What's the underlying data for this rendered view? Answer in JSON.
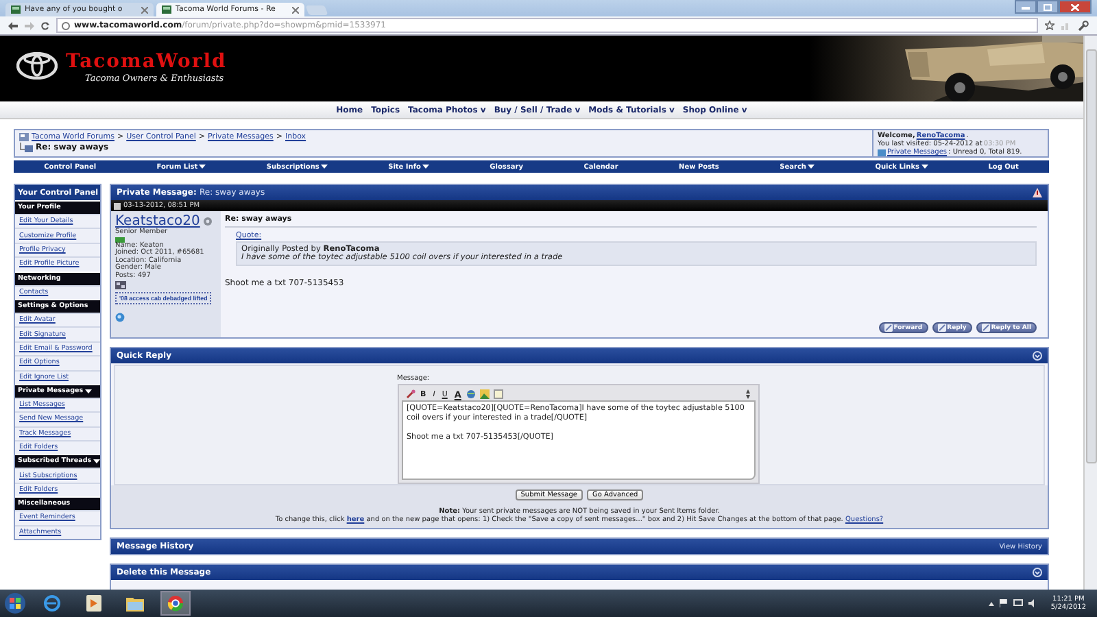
{
  "browser": {
    "tabs": [
      {
        "title": "Have any of you bought o",
        "selected": false
      },
      {
        "title": "Tacoma World Forums - Re",
        "selected": true
      }
    ],
    "url": {
      "domain": "www.tacomaworld.com",
      "path": "/forum/private.php?do=showpm&pmid=1533971"
    }
  },
  "banner": {
    "title": "TacomaWorld",
    "tagline": "Tacoma Owners & Enthusiasts"
  },
  "nav": [
    "Home",
    "Topics",
    "Tacoma Photos v",
    "Buy / Sell / Trade v",
    "Mods & Tutorials v",
    "Shop Online v"
  ],
  "breadcrumb": {
    "links": [
      "Tacoma World Forums",
      "User Control Panel",
      "Private Messages",
      "Inbox"
    ],
    "separator": ">",
    "current": "Re: sway aways"
  },
  "welcome": {
    "greeting": "Welcome,",
    "user": "RenoTacoma",
    "user_suffix": ".",
    "last_visit": "You last visited: 05-24-2012 at",
    "last_time": "03:30 PM",
    "pm_link": "Private Messages",
    "pm_counts": ": Unread 0, Total 819."
  },
  "menu_bar": [
    {
      "label": "Control Panel",
      "dropdown": false
    },
    {
      "label": "Forum List",
      "dropdown": true
    },
    {
      "label": "Subscriptions",
      "dropdown": true
    },
    {
      "label": "Site Info",
      "dropdown": true
    },
    {
      "label": "Glossary",
      "dropdown": false
    },
    {
      "label": "Calendar",
      "dropdown": false
    },
    {
      "label": "New Posts",
      "dropdown": false
    },
    {
      "label": "Search",
      "dropdown": true
    },
    {
      "label": "Quick Links",
      "dropdown": true
    },
    {
      "label": "Log Out",
      "dropdown": false
    }
  ],
  "sidebar": {
    "title": "Your Control Panel",
    "sections": [
      {
        "heading": "Your Profile",
        "dropdown": false,
        "items": [
          "Edit Your Details",
          "Customize Profile",
          "Profile Privacy",
          "Edit Profile Picture"
        ]
      },
      {
        "heading": "Networking",
        "dropdown": false,
        "items": [
          "Contacts"
        ]
      },
      {
        "heading": "Settings & Options",
        "dropdown": false,
        "items": [
          "Edit Avatar",
          "Edit Signature",
          "Edit Email & Password",
          "Edit Options",
          "Edit Ignore List"
        ]
      },
      {
        "heading": "Private Messages",
        "dropdown": true,
        "items": [
          "List Messages",
          "Send New Message",
          "Track Messages",
          "Edit Folders"
        ]
      },
      {
        "heading": "Subscribed Threads",
        "dropdown": true,
        "items": [
          "List Subscriptions",
          "Edit Folders"
        ]
      },
      {
        "heading": "Miscellaneous",
        "dropdown": false,
        "items": [
          "Event Reminders",
          "Attachments"
        ]
      }
    ]
  },
  "message": {
    "header_label": "Private Message:",
    "header_subject": "Re: sway aways",
    "date": "03-13-2012, 08:51 PM",
    "author": {
      "name": "Keatstaco20",
      "online": false,
      "title": "Senior Member",
      "details": [
        "Name: Keaton",
        "Joined: Oct 2011, #65681",
        "Location: California",
        "Gender: Male",
        "Posts: 497"
      ],
      "signature": "'08 access cab debadged lifted"
    },
    "subject": "Re: sway aways",
    "quote": {
      "label": "Quote:",
      "posted_by": "Originally Posted by **RenoTacoma**",
      "text": "I have some of the toytec adjustable 5100 coil overs if your interested in a trade"
    },
    "body": "Shoot me a txt 707-5135453",
    "buttons": [
      "Forward",
      "Reply",
      "Reply to All"
    ]
  },
  "quick_reply": {
    "title": "Quick Reply",
    "message_label": "Message:",
    "toolbar": [
      "B",
      "I",
      "U",
      "A"
    ],
    "value": "[QUOTE=Keatstaco20][QUOTE=RenoTacoma]I have some of the toytec adjustable 5100 coil overs if your interested in a trade[/QUOTE]\n\nShoot me a txt 707-5135453[/QUOTE]",
    "buttons": [
      "Submit Message",
      "Go Advanced"
    ],
    "note": "**Note:** Your sent private messages are NOT being saved in your Sent Items folder.",
    "change_before": "To change this, click",
    "change_link": "here",
    "change_after": "and on the new page that opens: 1) Check the \"Save a copy of sent messages...\" box and 2) Hit Save Changes at the bottom of that page.",
    "questions_link": "Questions?"
  },
  "message_history": {
    "title": "Message History",
    "action": "View History"
  },
  "delete_message": {
    "title": "Delete this Message"
  },
  "taskbar": {
    "apps": [
      {
        "kind": "globe",
        "selected": false
      },
      {
        "kind": "player",
        "selected": false
      },
      {
        "kind": "folder",
        "selected": false
      },
      {
        "kind": "browser",
        "selected": true
      }
    ],
    "time": "11:21 PM",
    "date": "5/24/2012"
  }
}
